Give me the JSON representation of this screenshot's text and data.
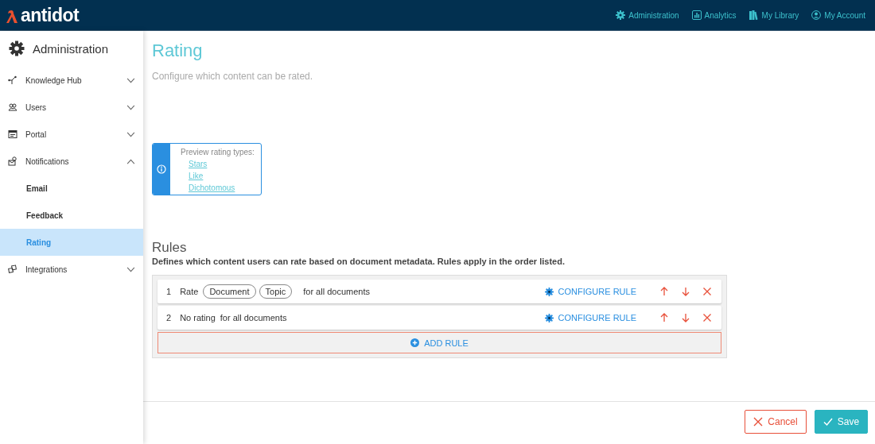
{
  "header": {
    "logo": "antidot",
    "nav": [
      {
        "label": "Administration"
      },
      {
        "label": "Analytics"
      },
      {
        "label": "My Library"
      },
      {
        "label": "My Account"
      }
    ]
  },
  "sidebar": {
    "title": "Administration",
    "items": [
      {
        "label": "Knowledge Hub",
        "expanded": false
      },
      {
        "label": "Users",
        "expanded": false
      },
      {
        "label": "Portal",
        "expanded": false
      },
      {
        "label": "Notifications",
        "expanded": true,
        "children": [
          {
            "label": "Email",
            "selected": false
          },
          {
            "label": "Feedback",
            "selected": false
          },
          {
            "label": "Rating",
            "selected": true
          }
        ]
      },
      {
        "label": "Integrations",
        "expanded": false
      }
    ]
  },
  "page": {
    "title": "Rating",
    "subtitle": "Configure which content can be rated."
  },
  "info": {
    "heading": "Preview rating types:",
    "links": [
      "Stars",
      "Like",
      "Dichotomous"
    ]
  },
  "rules": {
    "title": "Rules",
    "description": "Defines which content users can rate based on document metadata. Rules apply in the order listed.",
    "items": [
      {
        "number": "1",
        "action": "Rate",
        "tags": [
          "Document",
          "Topic"
        ],
        "scope": "for all documents",
        "configure": "CONFIGURE RULE"
      },
      {
        "number": "2",
        "action": "No rating",
        "scope": "for all documents",
        "configure": "CONFIGURE RULE"
      }
    ],
    "add": "ADD RULE"
  },
  "footer": {
    "cancel": "Cancel",
    "save": "Save"
  }
}
